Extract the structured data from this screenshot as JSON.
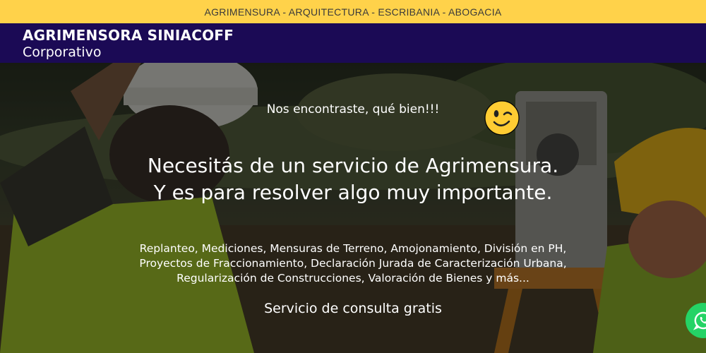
{
  "topbar": {
    "services": "AGRIMENSURA - ARQUITECTURA - ESCRIBANIA - ABOGACIA"
  },
  "header": {
    "brand": "AGRIMENSORA SINIACOFF",
    "subtitle": "Corporativo"
  },
  "hero": {
    "intro": "Nos encontraste, qué bien!!!",
    "intro_emoji": "winking-face-emoji",
    "headline_line1": "Necesitás de un servicio de Agrimensura.",
    "headline_line2": "Y es para resolver algo muy importante.",
    "description": "Replanteo, Mediciones, Mensuras de Terreno, Amojonamiento, División en PH, Proyectos de Fraccionamiento, Declaración Jurada de Caracterización Urbana, Regularización de Construcciones, Valoración de Bienes y más...",
    "cta": "Servicio de consulta gratis"
  },
  "floating": {
    "whatsapp_icon": "whatsapp-icon"
  },
  "colors": {
    "topbar": "#ffd24a",
    "header": "#1b0a55",
    "whatsapp": "#25d366",
    "text": "#ffffff"
  }
}
